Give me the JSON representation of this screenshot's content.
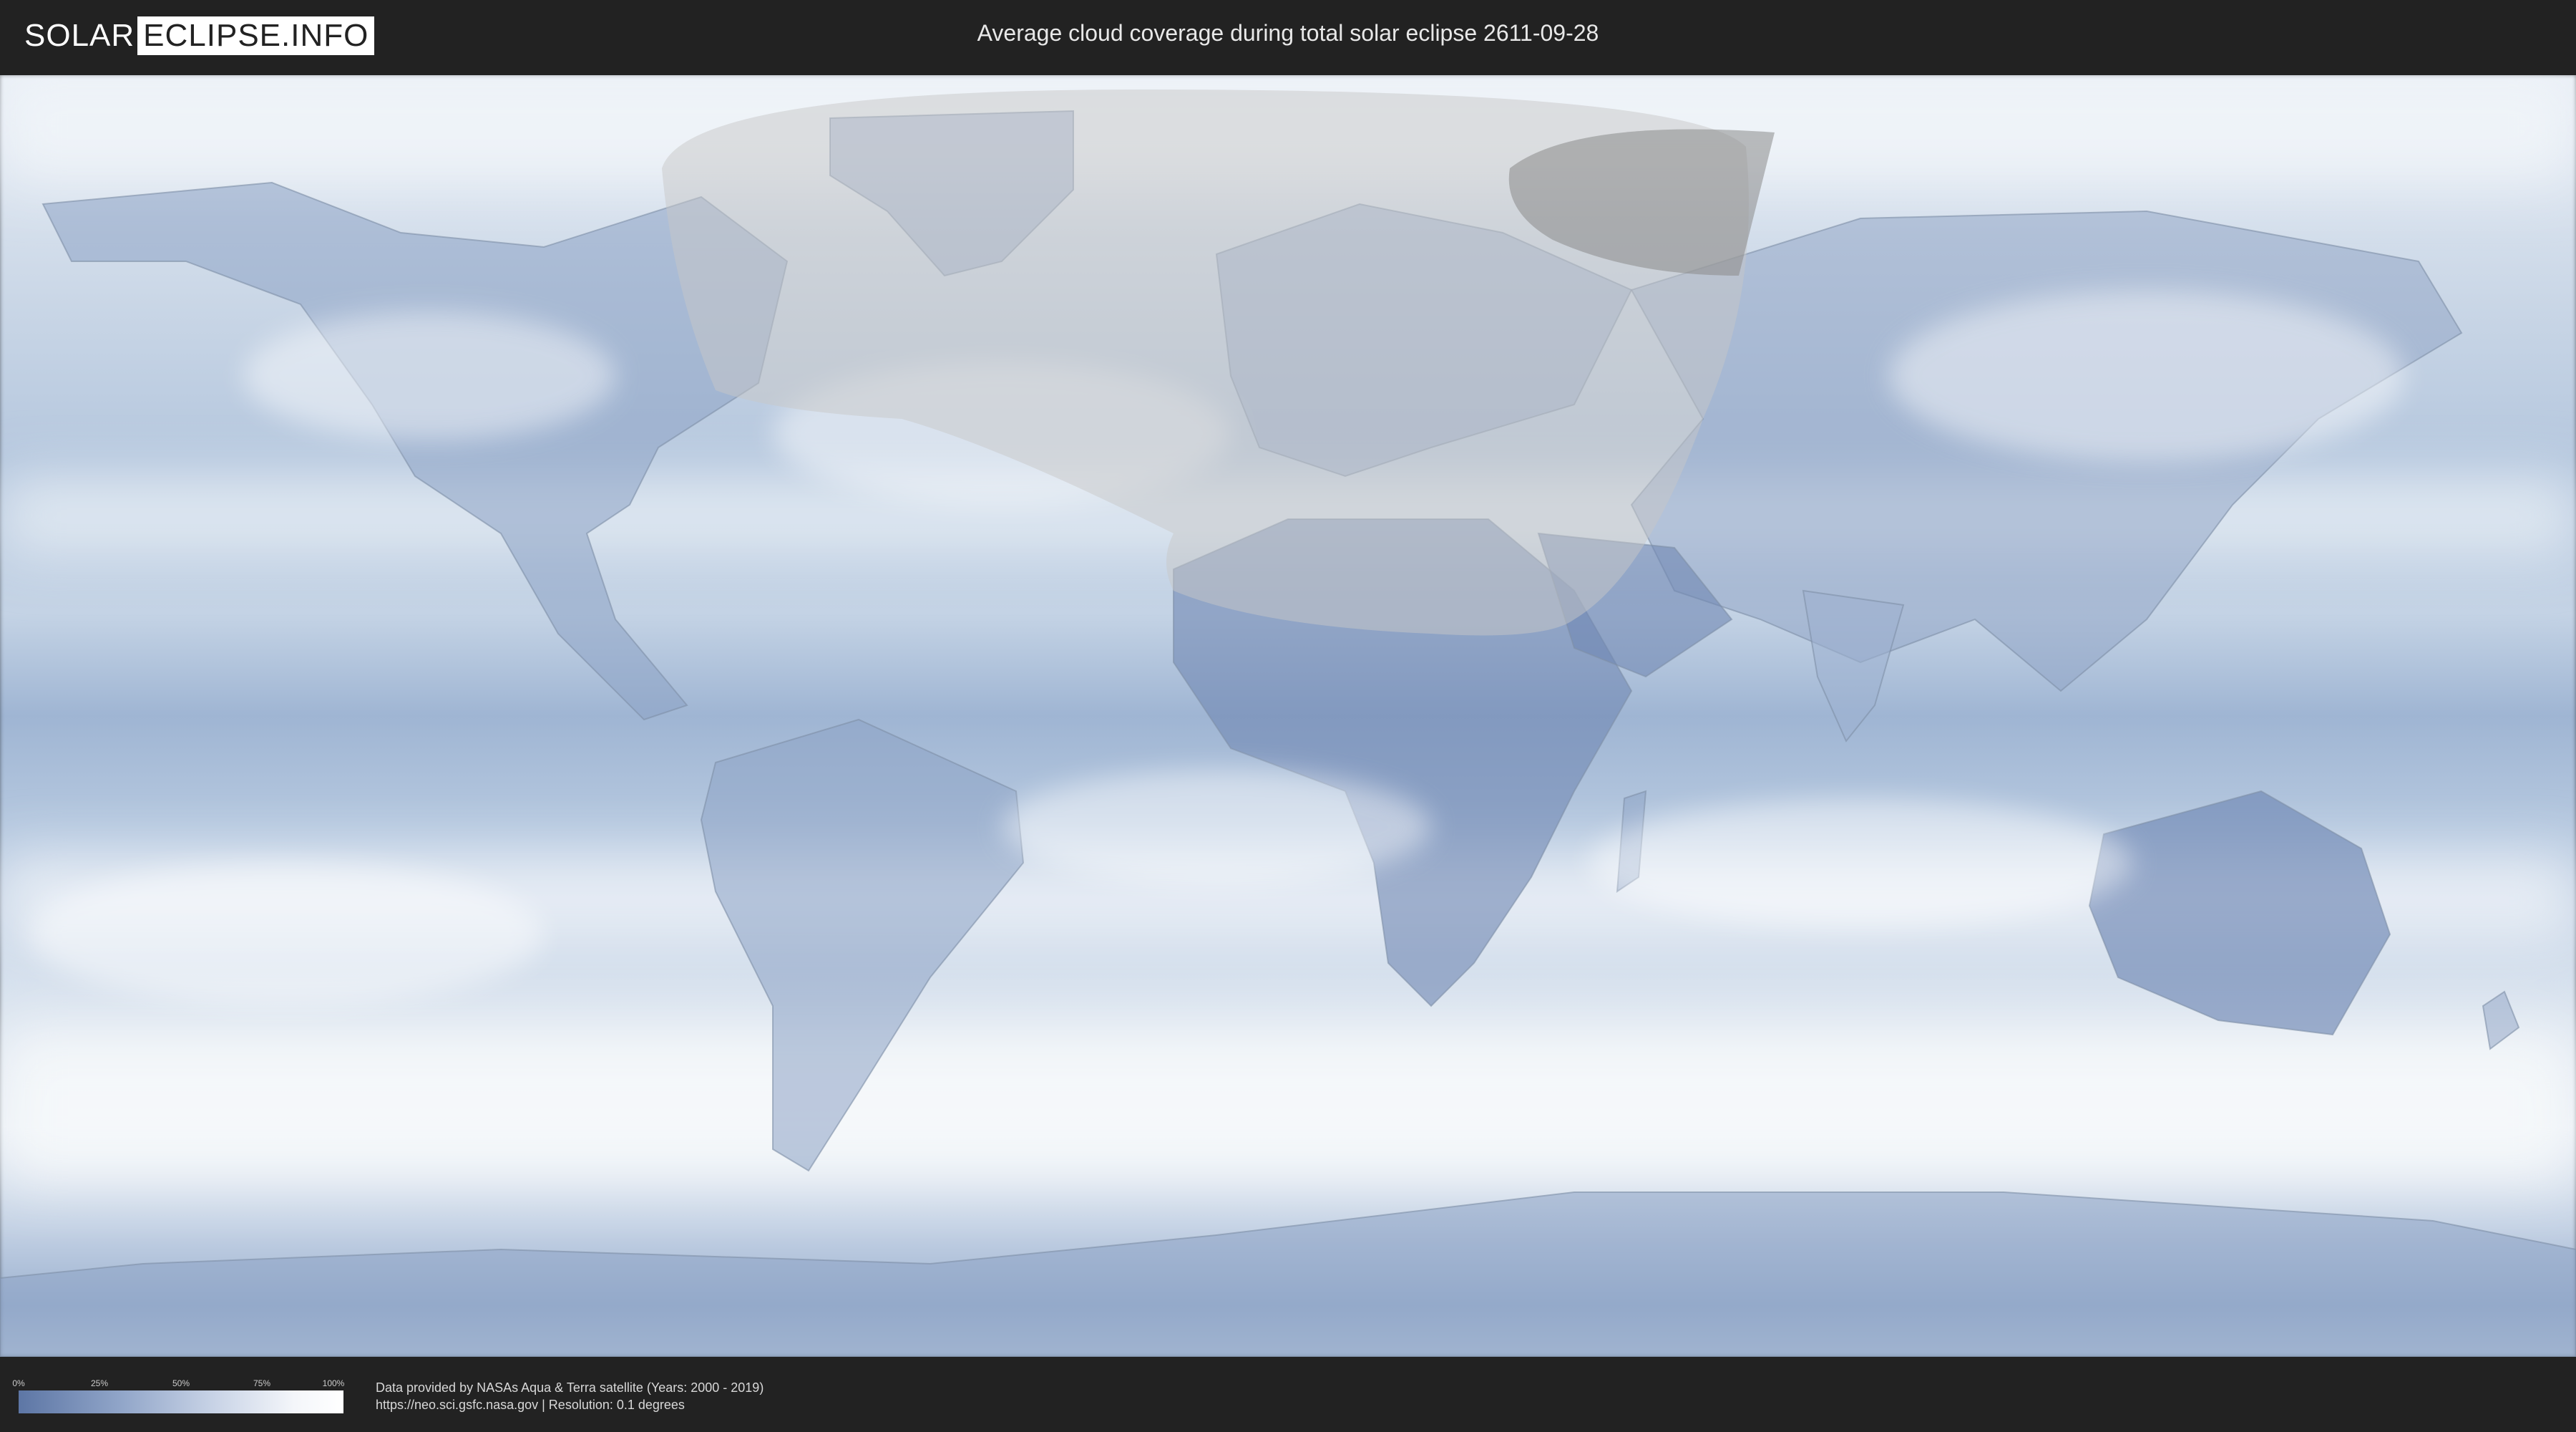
{
  "header": {
    "logo_left": "SOLAR",
    "logo_right": "ECLIPSE.INFO",
    "title": "Average cloud coverage during total solar eclipse 2611-09-28"
  },
  "map": {
    "ocean_color": "#b5c7de",
    "clear_sky_color": "#5d76a5",
    "cloud_color": "#ffffff",
    "eclipse_shadow_color": "#9a9a9a"
  },
  "legend": {
    "ticks": [
      "0%",
      "25%",
      "50%",
      "75%",
      "100%"
    ],
    "gradient_start": "#5d76a5",
    "gradient_end": "#ffffff"
  },
  "footer": {
    "source_line": "Data provided by NASAs Aqua & Terra satellite (Years: 2000 - 2019)",
    "url_line": "https://neo.sci.gsfc.nasa.gov | Resolution: 0.1 degrees"
  }
}
